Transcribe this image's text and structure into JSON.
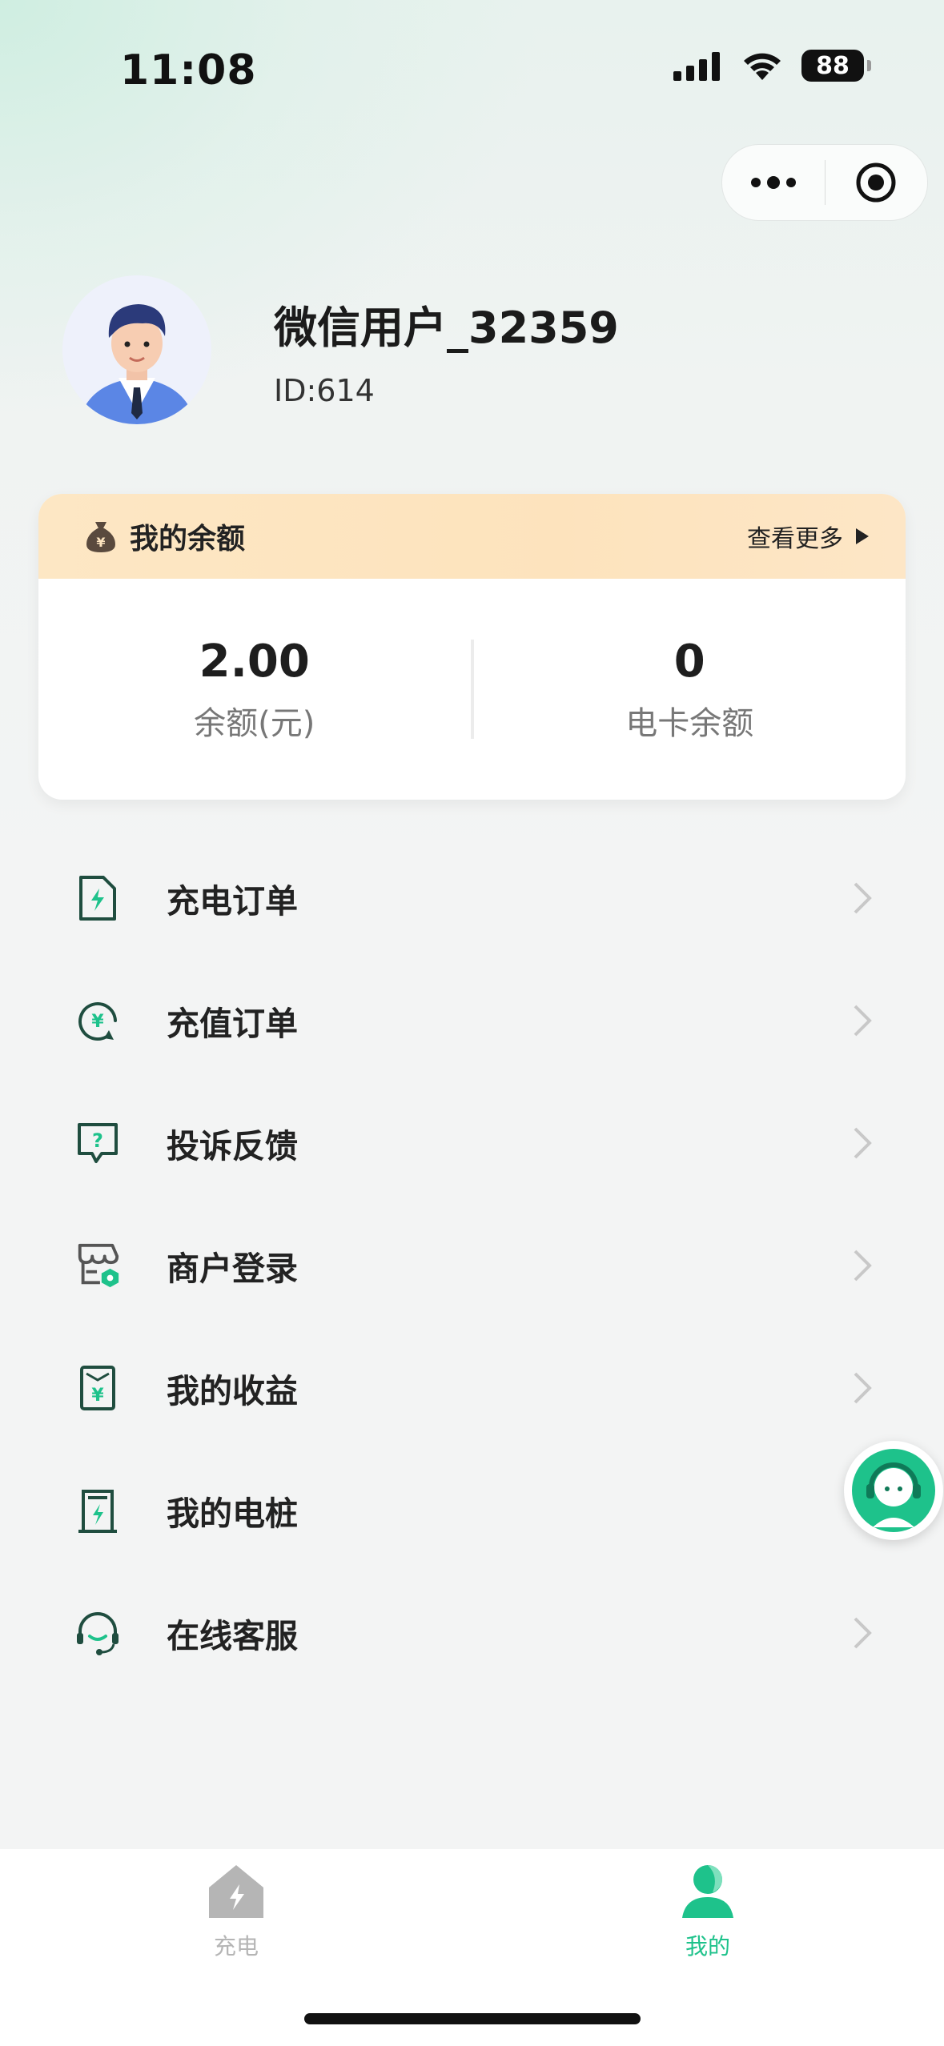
{
  "status_bar": {
    "time": "11:08",
    "battery": "88"
  },
  "capsule": {
    "more_icon": "more-dots-icon",
    "close_icon": "target-circle-icon"
  },
  "profile": {
    "username": "微信用户_32359",
    "user_id": "ID:614"
  },
  "balance_card": {
    "title": "我的余额",
    "more_label": "查看更多",
    "stats": [
      {
        "value": "2.00",
        "label": "余额(元)"
      },
      {
        "value": "0",
        "label": "电卡余额"
      }
    ]
  },
  "menu": {
    "items": [
      {
        "label": "充电订单",
        "icon": "charging-order-icon",
        "chevron": true
      },
      {
        "label": "充值订单",
        "icon": "recharge-order-icon",
        "chevron": true
      },
      {
        "label": "投诉反馈",
        "icon": "feedback-icon",
        "chevron": true
      },
      {
        "label": "商户登录",
        "icon": "merchant-store-icon",
        "chevron": true
      },
      {
        "label": "我的收益",
        "icon": "earnings-icon",
        "chevron": true
      },
      {
        "label": "我的电桩",
        "icon": "charging-pile-icon",
        "chevron": false
      },
      {
        "label": "在线客服",
        "icon": "headset-icon",
        "chevron": true
      }
    ]
  },
  "tabbar": {
    "tabs": [
      {
        "label": "充电",
        "active": false
      },
      {
        "label": "我的",
        "active": true
      }
    ]
  },
  "colors": {
    "accent": "#1ec28b",
    "icon_dark": "#1f4d3f",
    "inactive": "#b5b5b5",
    "card_header": "#fde4bf"
  }
}
